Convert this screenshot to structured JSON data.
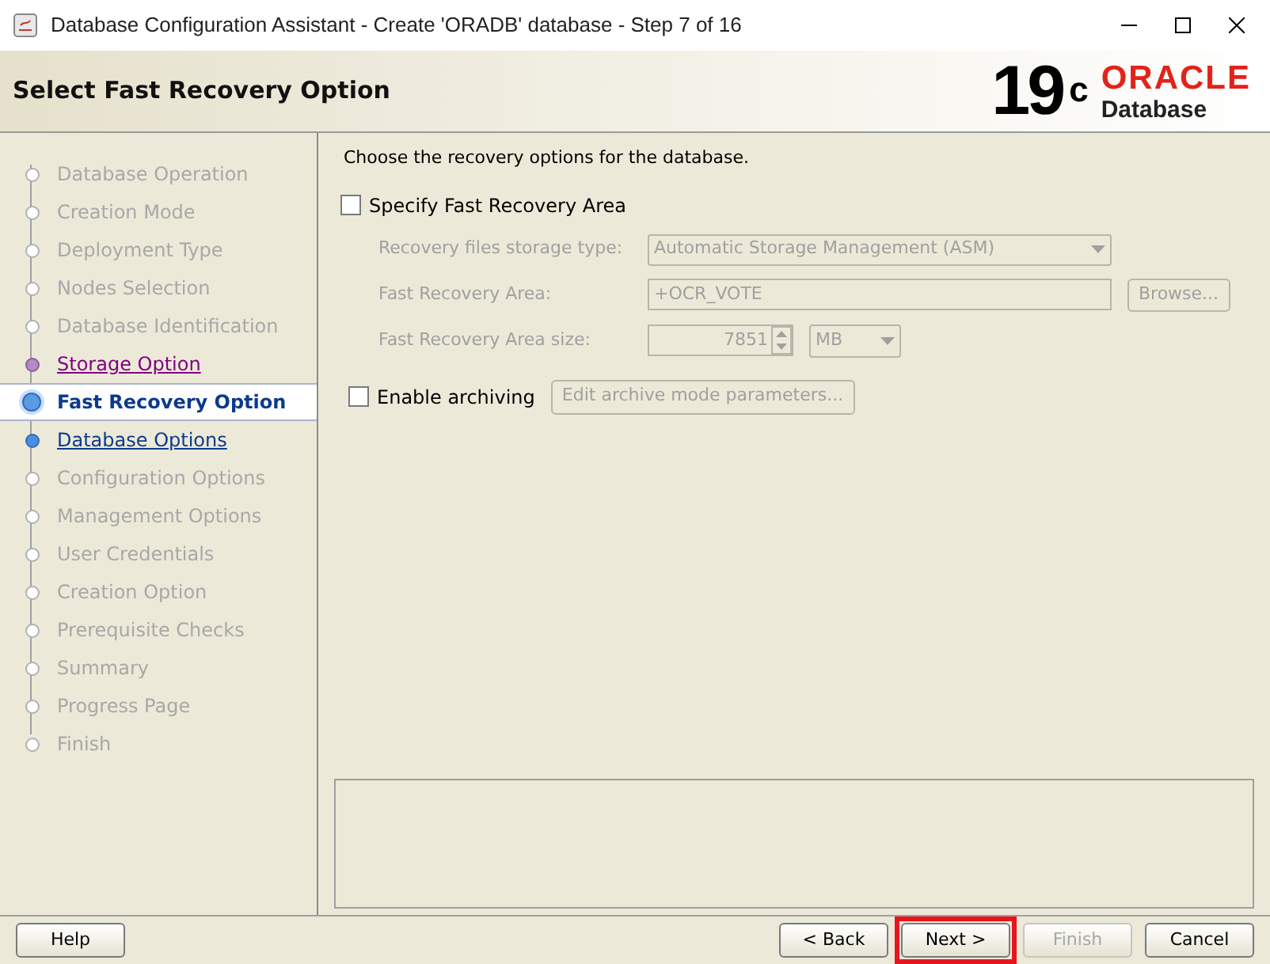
{
  "window": {
    "title": "Database Configuration Assistant - Create 'ORADB' database - Step 7 of 16"
  },
  "header": {
    "title": "Select Fast Recovery Option",
    "version": "19",
    "version_suffix": "c",
    "brand": "ORACLE",
    "product": "Database"
  },
  "steps": [
    {
      "label": "Database Operation",
      "kind": "disabled",
      "selected": false
    },
    {
      "label": "Creation Mode",
      "kind": "disabled",
      "selected": false
    },
    {
      "label": "Deployment Type",
      "kind": "disabled",
      "selected": false
    },
    {
      "label": "Nodes Selection",
      "kind": "disabled",
      "selected": false
    },
    {
      "label": "Database Identification",
      "kind": "disabled",
      "selected": false
    },
    {
      "label": "Storage Option",
      "kind": "visited",
      "selected": false
    },
    {
      "label": "Fast Recovery Option",
      "kind": "current",
      "selected": true
    },
    {
      "label": "Database Options",
      "kind": "available",
      "selected": false
    },
    {
      "label": "Configuration Options",
      "kind": "disabled",
      "selected": false
    },
    {
      "label": "Management Options",
      "kind": "disabled",
      "selected": false
    },
    {
      "label": "User Credentials",
      "kind": "disabled",
      "selected": false
    },
    {
      "label": "Creation Option",
      "kind": "disabled",
      "selected": false
    },
    {
      "label": "Prerequisite Checks",
      "kind": "disabled",
      "selected": false
    },
    {
      "label": "Summary",
      "kind": "disabled",
      "selected": false
    },
    {
      "label": "Progress Page",
      "kind": "disabled",
      "selected": false
    },
    {
      "label": "Finish",
      "kind": "disabled",
      "selected": false
    }
  ],
  "content": {
    "intro": "Choose the recovery options for the database.",
    "specify_fra": {
      "label": "Specify Fast Recovery Area",
      "checked": false
    },
    "storage_type": {
      "label": "Recovery files storage type:",
      "value": "Automatic Storage Management (ASM)",
      "disabled": true
    },
    "fra_location": {
      "label": "Fast Recovery Area:",
      "value": "+OCR_VOTE",
      "disabled": true,
      "browse": "Browse..."
    },
    "fra_size": {
      "label": "Fast Recovery Area size:",
      "value": "7851",
      "unit": "MB",
      "disabled": true
    },
    "archiving": {
      "label": "Enable archiving",
      "checked": false,
      "button": "Edit archive mode parameters...",
      "button_disabled": true
    }
  },
  "buttons": [
    {
      "label": "Help",
      "disabled": false,
      "highlighted": false
    },
    {
      "label": "< Back",
      "disabled": false,
      "highlighted": false
    },
    {
      "label": "Next >",
      "disabled": false,
      "highlighted": true
    },
    {
      "label": "Finish",
      "disabled": true,
      "highlighted": false
    },
    {
      "label": "Cancel",
      "disabled": false,
      "highlighted": false
    }
  ]
}
